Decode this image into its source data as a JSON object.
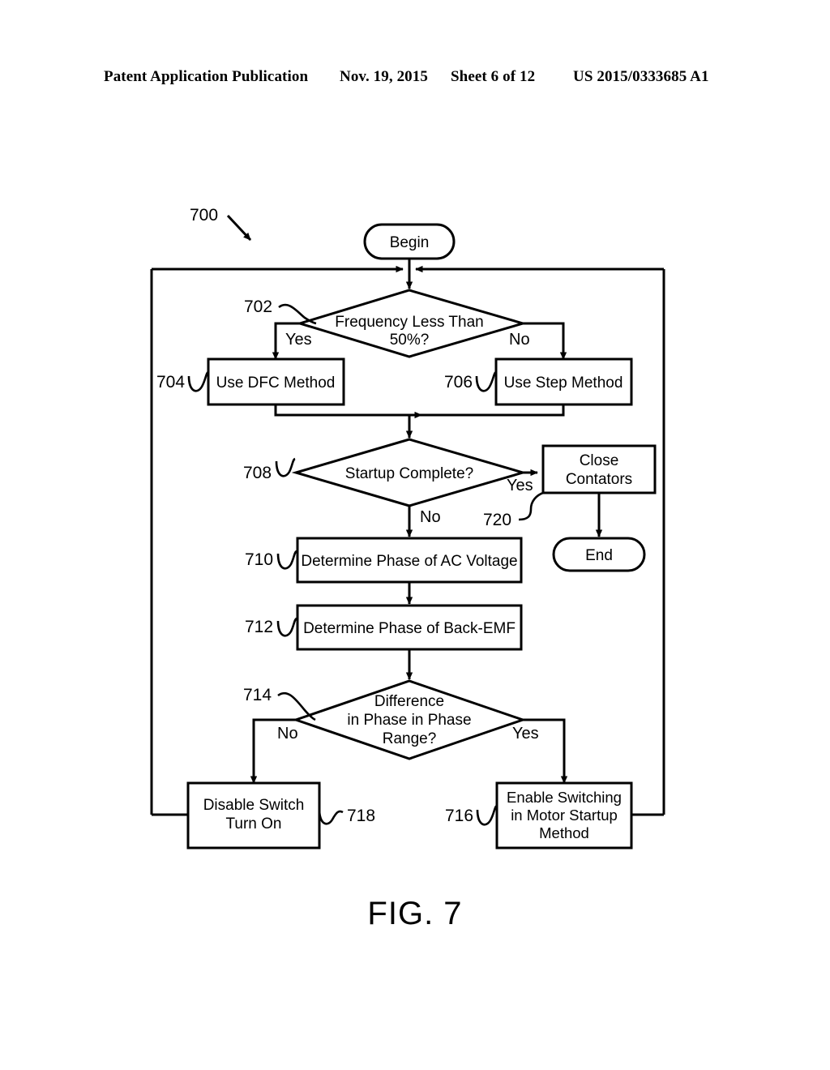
{
  "header": {
    "publication": "Patent Application Publication",
    "date": "Nov. 19, 2015",
    "sheet": "Sheet 6 of 12",
    "document_number": "US 2015/0333685 A1"
  },
  "figure": {
    "caption": "FIG. 7",
    "diagram_ref": "700"
  },
  "nodes": {
    "begin": {
      "label": "Begin",
      "ref": ""
    },
    "freq_check": {
      "label_line1": "Frequency Less Than",
      "label_line2": "50%?",
      "ref": "702"
    },
    "dfc": {
      "label": "Use DFC Method",
      "ref": "704"
    },
    "step": {
      "label": "Use Step Method",
      "ref": "706"
    },
    "startup_check": {
      "label": "Startup Complete?",
      "ref": "708"
    },
    "close_contators": {
      "label_line1": "Close",
      "label_line2": "Contators",
      "ref": "720"
    },
    "end": {
      "label": "End",
      "ref": ""
    },
    "determine_ac": {
      "label": "Determine Phase of AC Voltage",
      "ref": "710"
    },
    "determine_bemf": {
      "label": "Determine Phase of Back-EMF",
      "ref": "712"
    },
    "phase_range_check": {
      "label_line1": "Difference",
      "label_line2": "in Phase in Phase",
      "label_line3": "Range?",
      "ref": "714"
    },
    "disable_switch": {
      "label_line1": "Disable Switch",
      "label_line2": "Turn On",
      "ref": "718"
    },
    "enable_switching": {
      "label_line1": "Enable Switching",
      "label_line2": "in Motor Startup",
      "label_line3": "Method",
      "ref": "716"
    }
  },
  "edge_labels": {
    "freq_yes": "Yes",
    "freq_no": "No",
    "startup_yes": "Yes",
    "startup_no": "No",
    "phase_no": "No",
    "phase_yes": "Yes"
  },
  "colors": {
    "stroke": "#000000",
    "fill": "#ffffff",
    "text": "#000000"
  }
}
